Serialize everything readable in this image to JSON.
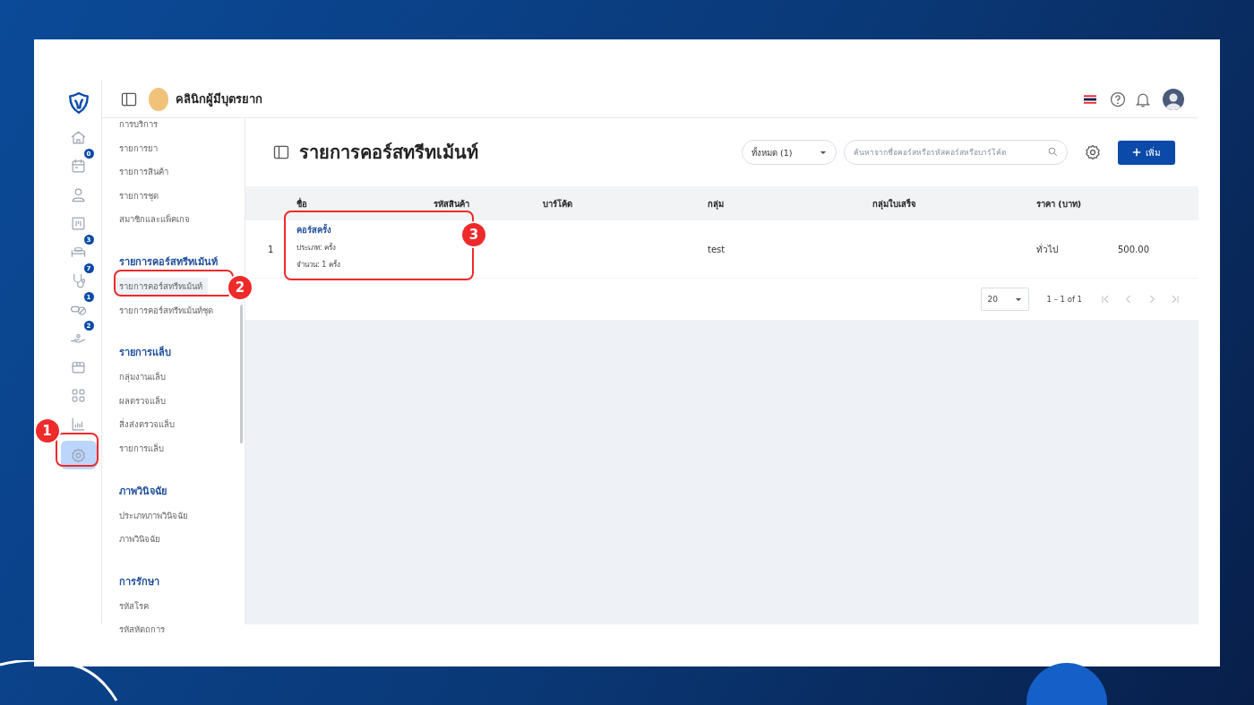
{
  "header": {
    "clinic_name": "คลินิกผู้มีบุตรยาก"
  },
  "rail": [
    {
      "selected": false
    },
    {
      "badge": "0",
      "selected": false
    },
    {
      "selected": false
    },
    {
      "selected": false
    },
    {
      "badge": "3",
      "selected": false
    },
    {
      "badge": "7",
      "selected": false
    },
    {
      "badge": "1",
      "selected": false
    },
    {
      "badge": "2",
      "selected": false
    },
    {
      "selected": false
    },
    {
      "selected": false
    },
    {
      "selected": false
    },
    {
      "selected": true,
      "callout": "1"
    }
  ],
  "submenu": [
    {
      "items": [
        {
          "label": "การบริการ",
          "selected": false
        },
        {
          "label": "รายการยา",
          "selected": false
        },
        {
          "label": "รายการสินค้า",
          "selected": false
        },
        {
          "label": "รายการชุด",
          "selected": false
        },
        {
          "label": "สมาชิกและแพ็คเกจ",
          "selected": false
        }
      ]
    },
    {
      "title": "รายการคอร์สทรีทเม้นท์",
      "items": [
        {
          "label": "รายการคอร์สทรีทเม้นท์",
          "selected": true,
          "callout": "2"
        },
        {
          "label": "รายการคอร์สทรีทเม้นท์ชุด",
          "selected": false
        }
      ]
    },
    {
      "title": "รายการแล็บ",
      "items": [
        {
          "label": "กลุ่มงานแล็บ",
          "selected": false
        },
        {
          "label": "ผลตรวจแล็บ",
          "selected": false
        },
        {
          "label": "สิ่งส่งตรวจแล็บ",
          "selected": false
        },
        {
          "label": "รายการแล็บ",
          "selected": false
        }
      ]
    },
    {
      "title": "ภาพวินิจฉัย",
      "items": [
        {
          "label": "ประเภทภาพวินิจฉัย",
          "selected": false
        },
        {
          "label": "ภาพวินิจฉัย",
          "selected": false
        }
      ]
    },
    {
      "title": "การรักษา",
      "items": [
        {
          "label": "รหัสโรค",
          "selected": false
        },
        {
          "label": "รหัสหัตถการ",
          "selected": false
        }
      ]
    }
  ],
  "page": {
    "title": "รายการคอร์สทรีทเม้นท์",
    "filter": "ทั้งหมด (1)",
    "search": {
      "placeholder": "ค้นหาจากชื่อคอร์สหรือรหัสคอร์สหรือบาร์โค้ด"
    },
    "add_button": "เพิ่ม"
  },
  "table": {
    "columns": [
      "ชื่อ",
      "รหัสสินค้า",
      "บาร์โค้ด",
      "กลุ่ม",
      "กลุ่มใบเสร็จ",
      "ราคา (บาท)"
    ],
    "rows": [
      {
        "number": "1",
        "name": "คอร์สครั้ง",
        "type": "ประเภท: ครั้ง",
        "quantity": "จำนวน:  1 ครั้ง",
        "group": "test",
        "price_type": "ทั่วไป",
        "price": "500.00",
        "callout": "3"
      }
    ]
  },
  "pagination": {
    "page_size": "20",
    "range": "1 – 1 of 1"
  }
}
